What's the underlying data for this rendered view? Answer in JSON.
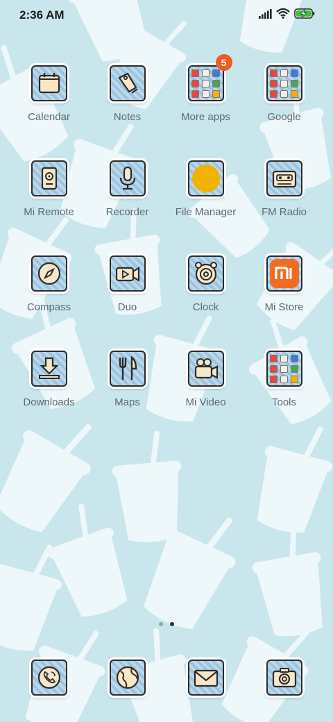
{
  "status": {
    "time": "2:36 AM"
  },
  "apps": [
    {
      "id": "calendar",
      "label": "Calendar",
      "icon": "calendar-icon"
    },
    {
      "id": "notes",
      "label": "Notes",
      "icon": "notes-tag-icon"
    },
    {
      "id": "more-apps",
      "label": "More apps",
      "icon": "folder-icon",
      "badge": "5"
    },
    {
      "id": "google",
      "label": "Google",
      "icon": "folder-icon"
    },
    {
      "id": "mi-remote",
      "label": "Mi Remote",
      "icon": "remote-icon"
    },
    {
      "id": "recorder",
      "label": "Recorder",
      "icon": "microphone-icon"
    },
    {
      "id": "file-manager",
      "label": "File Manager",
      "icon": "yellow-circle-icon"
    },
    {
      "id": "fm-radio",
      "label": "FM Radio",
      "icon": "radio-icon"
    },
    {
      "id": "compass",
      "label": "Compass",
      "icon": "compass-icon"
    },
    {
      "id": "duo",
      "label": "Duo",
      "icon": "video-camera-icon"
    },
    {
      "id": "clock",
      "label": "Clock",
      "icon": "alarm-clock-icon"
    },
    {
      "id": "mi-store",
      "label": "Mi Store",
      "icon": "mi-logo-icon"
    },
    {
      "id": "downloads",
      "label": "Downloads",
      "icon": "download-icon"
    },
    {
      "id": "maps",
      "label": "Maps",
      "icon": "fork-knife-icon"
    },
    {
      "id": "mi-video",
      "label": "Mi Video",
      "icon": "movie-camera-icon"
    },
    {
      "id": "tools",
      "label": "Tools",
      "icon": "folder-icon"
    }
  ],
  "dock": [
    {
      "id": "phone",
      "icon": "phone-icon"
    },
    {
      "id": "browser",
      "icon": "globe-icon"
    },
    {
      "id": "messages",
      "icon": "envelope-icon"
    },
    {
      "id": "camera",
      "icon": "camera-icon"
    }
  ],
  "pager": {
    "pages": 2,
    "current": 2
  },
  "colors": {
    "wallpaper": "#c9e6ed",
    "tile_stripe_dark": "#9dc4df",
    "tile_stripe_light": "#bcd8ea",
    "badge": "#f05a23",
    "mi_orange": "#f26b23",
    "file_manager_yellow": "#f2b200"
  }
}
